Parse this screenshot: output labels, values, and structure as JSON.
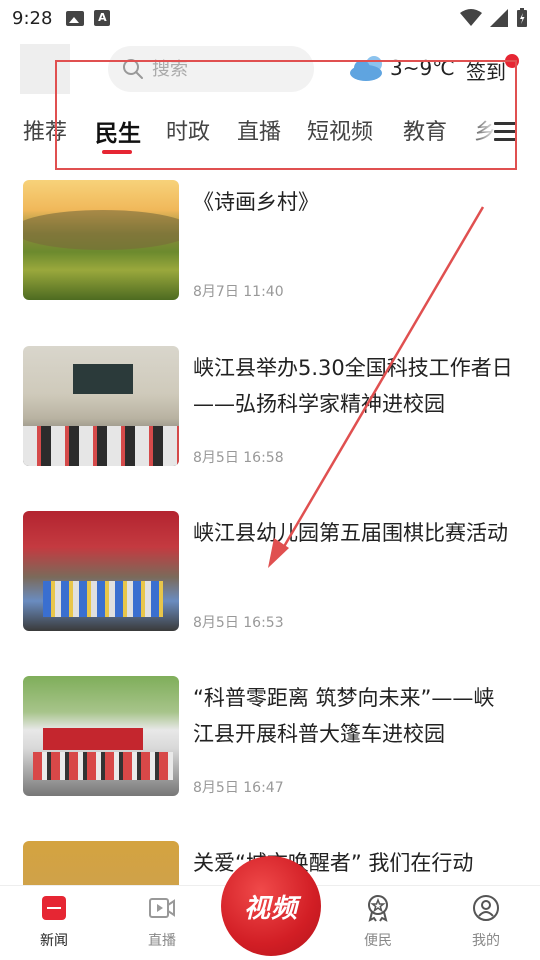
{
  "status_bar": {
    "time": "9:28"
  },
  "header": {
    "search_placeholder": "搜索",
    "weather_temp": "3~9℃",
    "checkin_label": "签到"
  },
  "tabs": [
    {
      "label": "推荐"
    },
    {
      "label": "民生",
      "active": true
    },
    {
      "label": "时政"
    },
    {
      "label": "直播"
    },
    {
      "label": "短视频"
    },
    {
      "label": "教育"
    },
    {
      "label": "乡"
    }
  ],
  "news": [
    {
      "title": "《诗画乡村》",
      "time": "8月7日 11:40"
    },
    {
      "title": "峡江县举办5.30全国科技工作者日——弘扬科学家精神进校园",
      "time": "8月5日 16:58"
    },
    {
      "title": "峡江县幼儿园第五届围棋比赛活动",
      "time": "8月5日 16:53"
    },
    {
      "title": "“科普零距离 筑梦向未来”——峡江县开展科普大篷车进校园",
      "time": "8月5日 16:47"
    },
    {
      "title": "关爱“城市唤醒者” 我们在行动",
      "time": ""
    }
  ],
  "bottom_nav": {
    "news": "新闻",
    "live": "直播",
    "video": "视频",
    "services": "便民",
    "mine": "我的"
  },
  "colors": {
    "accent": "#e62633",
    "annotation": "#e05050"
  }
}
